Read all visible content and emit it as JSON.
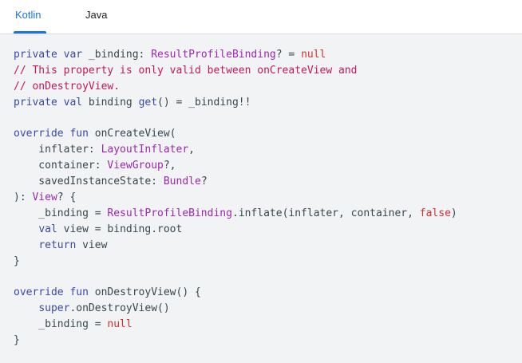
{
  "tabs": [
    {
      "label": "Kotlin",
      "selected": true
    },
    {
      "label": "Java",
      "selected": false
    }
  ],
  "colors": {
    "accent": "#1a73e8",
    "code_background": "#f1f3f4",
    "keyword": "#3949ab",
    "type": "#9c27b0",
    "literal": "#d32f2f",
    "comment": "#c2185b",
    "plain": "#37474f"
  },
  "code": {
    "language": "Kotlin",
    "lines": [
      [
        [
          "kw",
          "private"
        ],
        [
          "pl",
          " "
        ],
        [
          "kw",
          "var"
        ],
        [
          "pl",
          " _binding: "
        ],
        [
          "ty",
          "ResultProfileBinding"
        ],
        [
          "pl",
          "? = "
        ],
        [
          "lit",
          "null"
        ]
      ],
      [
        [
          "cm",
          "// This property is only valid between onCreateView and"
        ]
      ],
      [
        [
          "cm",
          "// onDestroyView."
        ]
      ],
      [
        [
          "kw",
          "private"
        ],
        [
          "pl",
          " "
        ],
        [
          "kw",
          "val"
        ],
        [
          "pl",
          " binding "
        ],
        [
          "kw",
          "get"
        ],
        [
          "pl",
          "() = _binding!!"
        ]
      ],
      [],
      [
        [
          "kw",
          "override"
        ],
        [
          "pl",
          " "
        ],
        [
          "kw",
          "fun"
        ],
        [
          "pl",
          " onCreateView("
        ]
      ],
      [
        [
          "pl",
          "    inflater: "
        ],
        [
          "ty",
          "LayoutInflater"
        ],
        [
          "pl",
          ","
        ]
      ],
      [
        [
          "pl",
          "    container: "
        ],
        [
          "ty",
          "ViewGroup"
        ],
        [
          "pl",
          "?,"
        ]
      ],
      [
        [
          "pl",
          "    savedInstanceState: "
        ],
        [
          "ty",
          "Bundle"
        ],
        [
          "pl",
          "?"
        ]
      ],
      [
        [
          "pl",
          "): "
        ],
        [
          "ty",
          "View"
        ],
        [
          "pl",
          "? {"
        ]
      ],
      [
        [
          "pl",
          "    _binding = "
        ],
        [
          "ty",
          "ResultProfileBinding"
        ],
        [
          "pl",
          ".inflate(inflater, container, "
        ],
        [
          "lit",
          "false"
        ],
        [
          "pl",
          ")"
        ]
      ],
      [
        [
          "pl",
          "    "
        ],
        [
          "kw",
          "val"
        ],
        [
          "pl",
          " view = binding.root"
        ]
      ],
      [
        [
          "pl",
          "    "
        ],
        [
          "kw",
          "return"
        ],
        [
          "pl",
          " view"
        ]
      ],
      [
        [
          "pl",
          "}"
        ]
      ],
      [],
      [
        [
          "kw",
          "override"
        ],
        [
          "pl",
          " "
        ],
        [
          "kw",
          "fun"
        ],
        [
          "pl",
          " onDestroyView() {"
        ]
      ],
      [
        [
          "pl",
          "    "
        ],
        [
          "kw",
          "super"
        ],
        [
          "pl",
          ".onDestroyView()"
        ]
      ],
      [
        [
          "pl",
          "    _binding = "
        ],
        [
          "lit",
          "null"
        ]
      ],
      [
        [
          "pl",
          "}"
        ]
      ]
    ]
  }
}
